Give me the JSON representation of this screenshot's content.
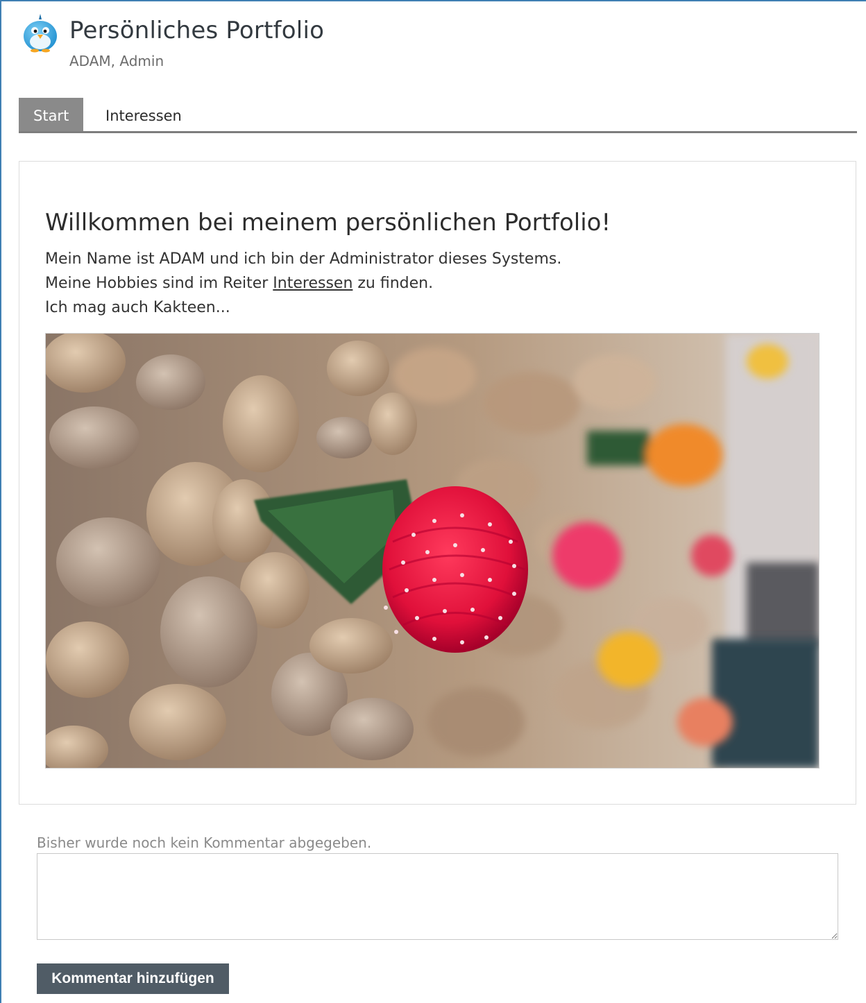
{
  "header": {
    "title": "Persönliches Portfolio",
    "subtitle": "ADAM, Admin",
    "avatar_icon": "bird-avatar-icon"
  },
  "tabs": [
    {
      "label": "Start",
      "active": true
    },
    {
      "label": "Interessen",
      "active": false
    }
  ],
  "content": {
    "heading": "Willkommen bei meinem persönlichen Portfolio!",
    "line1": "Mein Name ist ADAM und ich bin der Administrator dieses Systems.",
    "line2_before": "Meine Hobbies sind im Reiter ",
    "line2_link": "Interessen",
    "line2_after": " zu finden.",
    "line3": "Ich mag auch Kakteen...",
    "photo_subject": "moon cactus on pebbles"
  },
  "comments": {
    "empty_text": "Bisher wurde noch kein Kommentar abgegeben.",
    "textarea_value": "",
    "submit_label": "Kommentar hinzufügen"
  },
  "colors": {
    "frame_border": "#3f7fb3",
    "tab_active_bg": "#8a8a8a",
    "button_bg": "#505c66"
  }
}
